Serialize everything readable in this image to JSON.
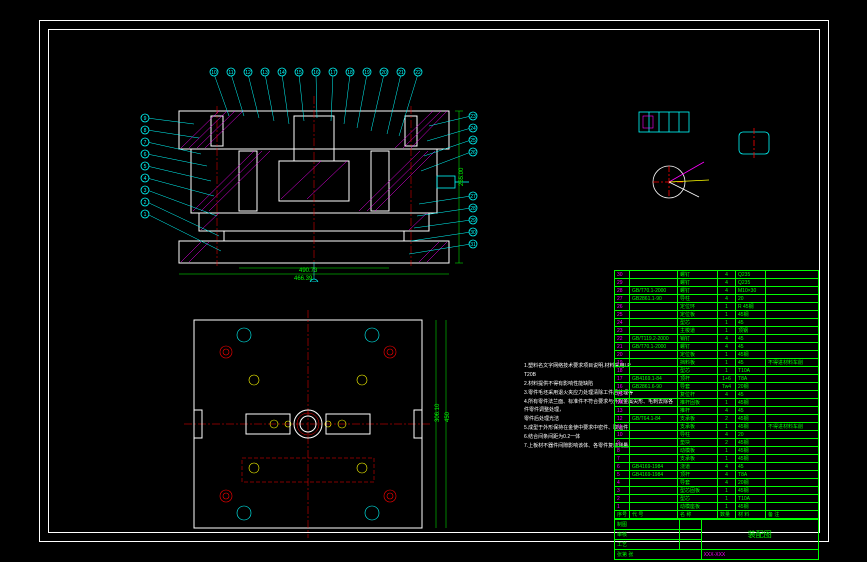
{
  "dimensions": {
    "section_height": "265.00",
    "section_width_lower": "490.73",
    "section_overall": "466.39",
    "plan_width": "306.10",
    "plan_height": "450"
  },
  "notes": {
    "n1": "1.塑料名文字网络技术要求项目说明.材料采用LP",
    "n1b": "   T20B",
    "n2": "2.材料提供不得有影响性能缺陷",
    "n3": "3.零件毛坯采用退火夹应力处理清除工件后处理等",
    "n4": "4.所有零件法兰面、标准件不符合要求与外观金属尖形、毛刺去除各件零件调整处理，",
    "n4b": "   零件后处理光洁",
    "n5": "5.成型于外形保持在金使中要求中密件、取运件",
    "n6": "6.结合间条间距为0.2一体",
    "n7": "7.上板材不器件间隙影响该体、各零件复动测量。"
  },
  "balloons": [
    "1",
    "2",
    "3",
    "4",
    "5",
    "6",
    "7",
    "8",
    "9",
    "10",
    "11",
    "12",
    "13",
    "14",
    "15",
    "16",
    "17",
    "18",
    "19",
    "20",
    "21",
    "22",
    "23",
    "24",
    "25",
    "26",
    "27",
    "28",
    "29",
    "30",
    "31",
    "32"
  ],
  "bom": [
    {
      "no": "30",
      "std": "",
      "name": "螺钉",
      "qty": "4",
      "mat": "Q235",
      "note": ""
    },
    {
      "no": "29",
      "std": "",
      "name": "螺钉",
      "qty": "4",
      "mat": "Q235",
      "note": ""
    },
    {
      "no": "28",
      "std": "GB/T70.1-2000",
      "name": "螺钉",
      "qty": "4",
      "mat": "M10×30",
      "note": ""
    },
    {
      "no": "27",
      "std": "GB2861.1-90",
      "name": "导柱",
      "qty": "4",
      "mat": "20",
      "note": ""
    },
    {
      "no": "26",
      "std": "",
      "name": "定位环",
      "qty": "1",
      "mat": "R  45钢",
      "note": ""
    },
    {
      "no": "25",
      "std": "",
      "name": "定位板",
      "qty": "1",
      "mat": "45钢",
      "note": ""
    },
    {
      "no": "24",
      "std": "",
      "name": "型芯",
      "qty": "1",
      "mat": "45",
      "note": ""
    },
    {
      "no": "23",
      "std": "",
      "name": "主梭道",
      "qty": "1",
      "mat": "顶钢",
      "note": ""
    },
    {
      "no": "22",
      "std": "GB/T119.2-2000",
      "name": "销钉",
      "qty": "4",
      "mat": "45",
      "note": ""
    },
    {
      "no": "21",
      "std": "GB/T70.1-2000",
      "name": "螺钉",
      "qty": "4",
      "mat": "45",
      "note": ""
    },
    {
      "no": "20",
      "std": "",
      "name": "定位板",
      "qty": "1",
      "mat": "45钢",
      "note": ""
    },
    {
      "no": "19",
      "std": "",
      "name": "挡料板",
      "qty": "1",
      "mat": "45",
      "note": "不得进材料车削"
    },
    {
      "no": "18",
      "std": "",
      "name": "型芯",
      "qty": "1",
      "mat": "T10A",
      "note": ""
    },
    {
      "no": "17",
      "std": "GB4169.1-84",
      "name": "顶杆",
      "qty": "1+6",
      "mat": "T8A",
      "note": ""
    },
    {
      "no": "16",
      "std": "GB2861.6-90",
      "name": "导套",
      "qty": "Tw4",
      "mat": "20钢",
      "note": ""
    },
    {
      "no": "15",
      "std": "",
      "name": "复位杆",
      "qty": "4",
      "mat": "45",
      "note": ""
    },
    {
      "no": "14",
      "std": "",
      "name": "推杆固板",
      "qty": "1",
      "mat": "45钢",
      "note": ""
    },
    {
      "no": "13",
      "std": "",
      "name": "推杆",
      "qty": "4",
      "mat": "45",
      "note": ""
    },
    {
      "no": "12",
      "std": "GB/T64.1-84",
      "name": "支承板",
      "qty": "2",
      "mat": "45钢",
      "note": ""
    },
    {
      "no": "11",
      "std": "",
      "name": "支承板",
      "qty": "1",
      "mat": "45钢",
      "note": "不得进材料车削"
    },
    {
      "no": "10",
      "std": "",
      "name": "导柱",
      "qty": "4",
      "mat": "20",
      "note": ""
    },
    {
      "no": "9",
      "std": "",
      "name": "垫块",
      "qty": "2",
      "mat": "45钢",
      "note": ""
    },
    {
      "no": "8",
      "std": "",
      "name": "动模板",
      "qty": "1",
      "mat": "45钢",
      "note": ""
    },
    {
      "no": "7",
      "std": "",
      "name": "支承板",
      "qty": "1",
      "mat": "45钢",
      "note": ""
    },
    {
      "no": "6",
      "std": "GB4169-1984",
      "name": "浇道",
      "qty": "4",
      "mat": "45",
      "note": ""
    },
    {
      "no": "5",
      "std": "GB4169-1984",
      "name": "顶杆",
      "qty": "4",
      "mat": "T8A",
      "note": ""
    },
    {
      "no": "4",
      "std": "",
      "name": "导套",
      "qty": "4",
      "mat": "20钢",
      "note": ""
    },
    {
      "no": "3",
      "std": "",
      "name": "型芯固板",
      "qty": "1",
      "mat": "45钢",
      "note": ""
    },
    {
      "no": "2",
      "std": "",
      "name": "型芯",
      "qty": "1",
      "mat": "T10A",
      "note": ""
    },
    {
      "no": "1",
      "std": "",
      "name": "动模座板",
      "qty": "1",
      "mat": "45钢",
      "note": ""
    }
  ],
  "bom_header": {
    "no": "序号",
    "std": "代 号",
    "name": "名  称",
    "qty": "数量",
    "mat": "材 料",
    "note": "备 注"
  },
  "titleblock": {
    "title": "装配图",
    "scale_label": "比例",
    "scale_value": "",
    "sheet": "张第  张",
    "drawn": "制图",
    "checked": "审核",
    "approved": "工艺",
    "company": "XXX-XXX"
  }
}
